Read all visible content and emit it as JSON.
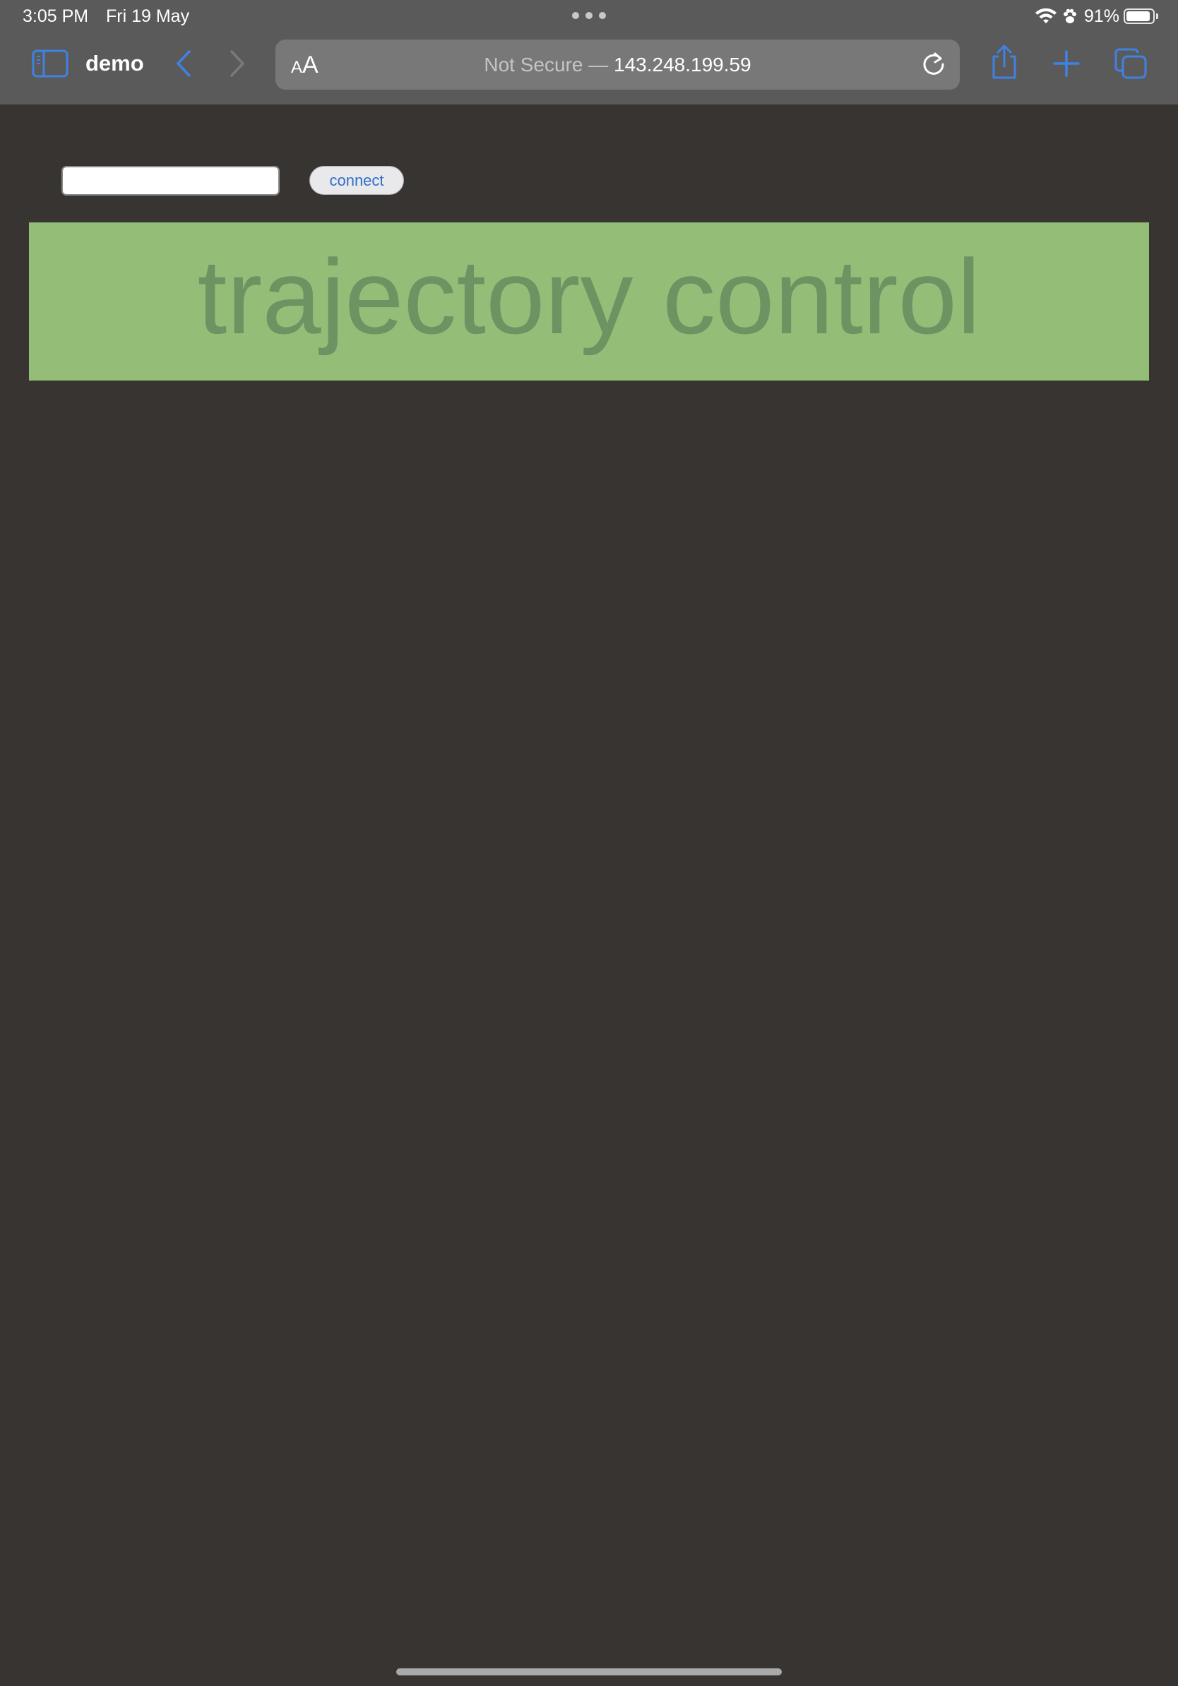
{
  "status_bar": {
    "time": "3:05 PM",
    "date": "Fri 19 May",
    "battery_percent_text": "91%",
    "battery_level": 0.91
  },
  "browser": {
    "tab_title": "demo",
    "address": {
      "text_size_button": "AA",
      "security_label": "Not Secure —",
      "host": "143.248.199.59"
    },
    "icons": {
      "sidebar": "sidebar-icon",
      "back": "chevron-left-icon",
      "forward": "chevron-right-icon",
      "reload": "reload-icon",
      "share": "share-icon",
      "new_tab": "plus-icon",
      "tabs": "tab-overview-icon"
    },
    "colors": {
      "chrome_bg": "#5a5a5a",
      "accent": "#3f82e4",
      "address_bg": "#787878"
    }
  },
  "page": {
    "input_value": "",
    "connect_label": "connect",
    "banner_title": "trajectory control",
    "colors": {
      "page_bg": "#383431",
      "banner_bg": "#94bd77",
      "banner_text": "#6e9262"
    }
  }
}
